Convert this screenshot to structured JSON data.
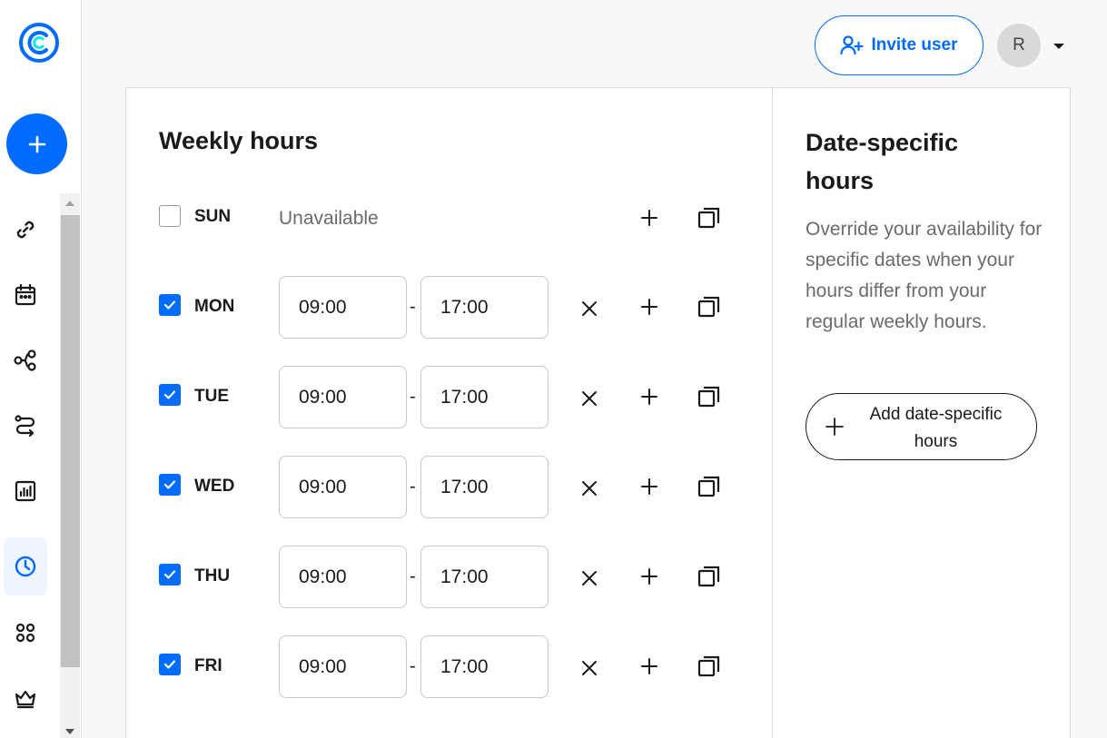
{
  "header": {
    "invite_label": "Invite user",
    "avatar_initial": "R"
  },
  "weekly": {
    "title": "Weekly hours",
    "separator": "-",
    "days": [
      {
        "label": "SUN",
        "checked": false,
        "status": "Unavailable"
      },
      {
        "label": "MON",
        "checked": true,
        "start": "09:00",
        "end": "17:00"
      },
      {
        "label": "TUE",
        "checked": true,
        "start": "09:00",
        "end": "17:00"
      },
      {
        "label": "WED",
        "checked": true,
        "start": "09:00",
        "end": "17:00"
      },
      {
        "label": "THU",
        "checked": true,
        "start": "09:00",
        "end": "17:00"
      },
      {
        "label": "FRI",
        "checked": true,
        "start": "09:00",
        "end": "17:00"
      }
    ]
  },
  "date_specific": {
    "title": "Date-specific hours",
    "description": "Override your availability for specific dates when your hours differ from your regular weekly hours.",
    "add_button_label": "Add date-specific hours"
  },
  "sidebar": {
    "items": [
      {
        "icon": "link-icon"
      },
      {
        "icon": "calendar-icon"
      },
      {
        "icon": "workflow-icon"
      },
      {
        "icon": "routing-icon"
      },
      {
        "icon": "analytics-icon"
      },
      {
        "icon": "clock-icon",
        "active": true
      },
      {
        "icon": "apps-icon"
      },
      {
        "icon": "crown-icon"
      }
    ]
  },
  "colors": {
    "brand": "#006bff",
    "text": "#1a1a1a",
    "muted": "#6b6b6b"
  }
}
